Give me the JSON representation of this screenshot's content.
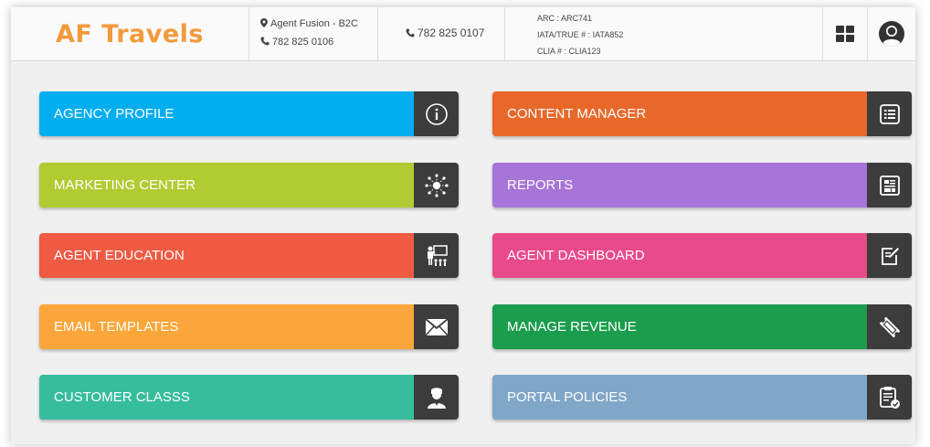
{
  "header": {
    "brand": "AF Travels",
    "agent_name": "Agent Fusion - B2C",
    "agent_phone": "782 825 0106",
    "phone": "782 825 0107",
    "arc": "ARC : ARC741",
    "iata": "IATA/TRUE # : IATA852",
    "clia": "CLIA # : CLIA123",
    "brand_color": "#f39a3d"
  },
  "tiles": [
    {
      "label": "AGENCY PROFILE",
      "color": "#03aef0",
      "icon": "info-icon"
    },
    {
      "label": "CONTENT MANAGER",
      "color": "#e8682a",
      "icon": "list-icon"
    },
    {
      "label": "MARKETING CENTER",
      "color": "#b1cb32",
      "icon": "network-icon"
    },
    {
      "label": "REPORTS",
      "color": "#a774d8",
      "icon": "report-icon"
    },
    {
      "label": "AGENT EDUCATION",
      "color": "#ef5a43",
      "icon": "presentation-icon"
    },
    {
      "label": "AGENT DASHBOARD",
      "color": "#e94a89",
      "icon": "edit-icon"
    },
    {
      "label": "EMAIL TEMPLATES",
      "color": "#fba63a",
      "icon": "envelope-icon"
    },
    {
      "label": "MANAGE REVENUE",
      "color": "#1b9d4d",
      "icon": "ticket-icon"
    },
    {
      "label": "CUSTOMER CLASSS",
      "color": "#36bd9c",
      "icon": "user-icon"
    },
    {
      "label": "PORTAL POLICIES",
      "color": "#80a6c8",
      "icon": "clipboard-check-icon"
    }
  ]
}
